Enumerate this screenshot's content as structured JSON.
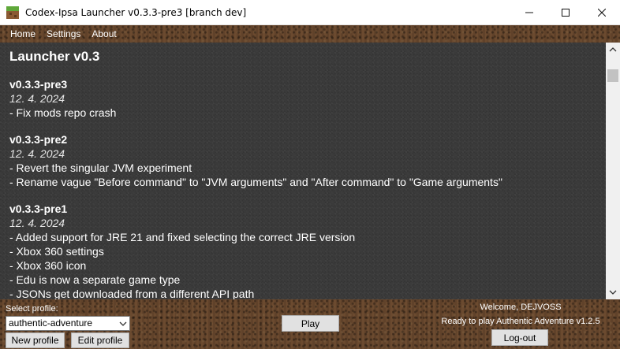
{
  "window": {
    "title": "Codex-Ipsa Launcher v0.3.3-pre3 [branch dev]",
    "controls": {
      "minimize": "—",
      "maximize": "☐",
      "close": "✕"
    }
  },
  "menu": {
    "items": [
      {
        "label": "Home"
      },
      {
        "label": "Settings"
      },
      {
        "label": "About"
      }
    ]
  },
  "changelog": {
    "heading": "Launcher v0.3",
    "releases": [
      {
        "version": "v0.3.3-pre3",
        "date": "12. 4. 2024",
        "changes": [
          "- Fix mods repo crash"
        ]
      },
      {
        "version": "v0.3.3-pre2",
        "date": "12. 4. 2024",
        "changes": [
          "- Revert the singular JVM experiment",
          "- Rename vague \"Before command\" to \"JVM arguments\" and \"After command\" to \"Game arguments\""
        ]
      },
      {
        "version": "v0.3.3-pre1",
        "date": "12. 4. 2024",
        "changes": [
          "- Added support for JRE 21 and fixed selecting the correct JRE version",
          "- Xbox 360 settings",
          "- Xbox 360 icon",
          "- Edu is now a separate game type",
          "- JSONs get downloaded from a different API path"
        ]
      }
    ]
  },
  "footer": {
    "profile_label": "Select profile:",
    "profile_selected": "authentic-adventure",
    "new_profile": "New profile",
    "edit_profile": "Edit profile",
    "play": "Play",
    "welcome": "Welcome, DEJVOSS",
    "ready": "Ready to play Authentic Adventure v1.2.5",
    "logout": "Log-out"
  }
}
